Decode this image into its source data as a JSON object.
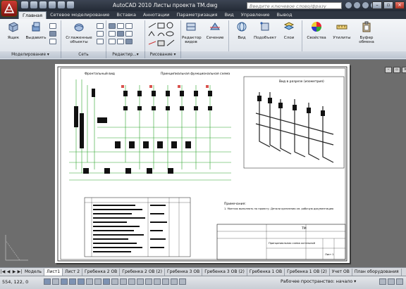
{
  "titlebar": {
    "title": "AutoCAD 2010    Листы проекта ТМ.dwg",
    "search_placeholder": "Введите ключевое слово/фразу"
  },
  "tabs": [
    "Главная",
    "Сетевое моделирование",
    "Вставка",
    "Аннотации",
    "Параметризация",
    "Вид",
    "Управление",
    "Вывод"
  ],
  "ribbon": {
    "buttons": {
      "box": "Ящик",
      "extrude": "Выдавить",
      "smooth": "Сглаженные объекты",
      "edit_view": "Редактор видов",
      "section": "Сечение",
      "view": "Вид",
      "subobject": "Подобъект",
      "layers": "Слои",
      "properties": "Свойства",
      "utilities": "Утилиты",
      "clipboard": "Буфер обмена"
    },
    "groups": {
      "modeling": "Моделирование ▾",
      "mesh": "Сеть",
      "solid_edit": "Редактир...▾",
      "draw": "Рисование ▾"
    }
  },
  "drawing": {
    "left_title": "Фронтальный вид",
    "center_title": "Принципиальная функциональная схема",
    "right_title": "Вид в разрезе (изометрия)",
    "notes_title": "Примечания:",
    "notes_text": "1. Монтаж выполнять по проекту. Детали крепления см. рабочую документацию",
    "stamp_code": "ТМ",
    "stamp_title": "Принципиальная схема котельной",
    "stamp_sheet": "Лист 1"
  },
  "layout_tabs": [
    "Модель",
    "Лист1",
    "Лист 2",
    "Гребенка 2 ОВ",
    "Гребенка 2 ОВ (2)",
    "Гребенка 3 ОВ",
    "Гребенка 3 ОВ (2)",
    "Гребенка 1 ОВ",
    "Гребенка 1 ОВ (2)",
    "Учет ОВ",
    "План оборудования"
  ],
  "statusbar": {
    "coords": "554, 122, 0",
    "workspace": "Рабочее пространство: начало ▾"
  },
  "colors": {
    "accent": "#cc3a32",
    "drawing_green": "#2ca52c",
    "ribbon_bg": "#e9ecf0"
  }
}
